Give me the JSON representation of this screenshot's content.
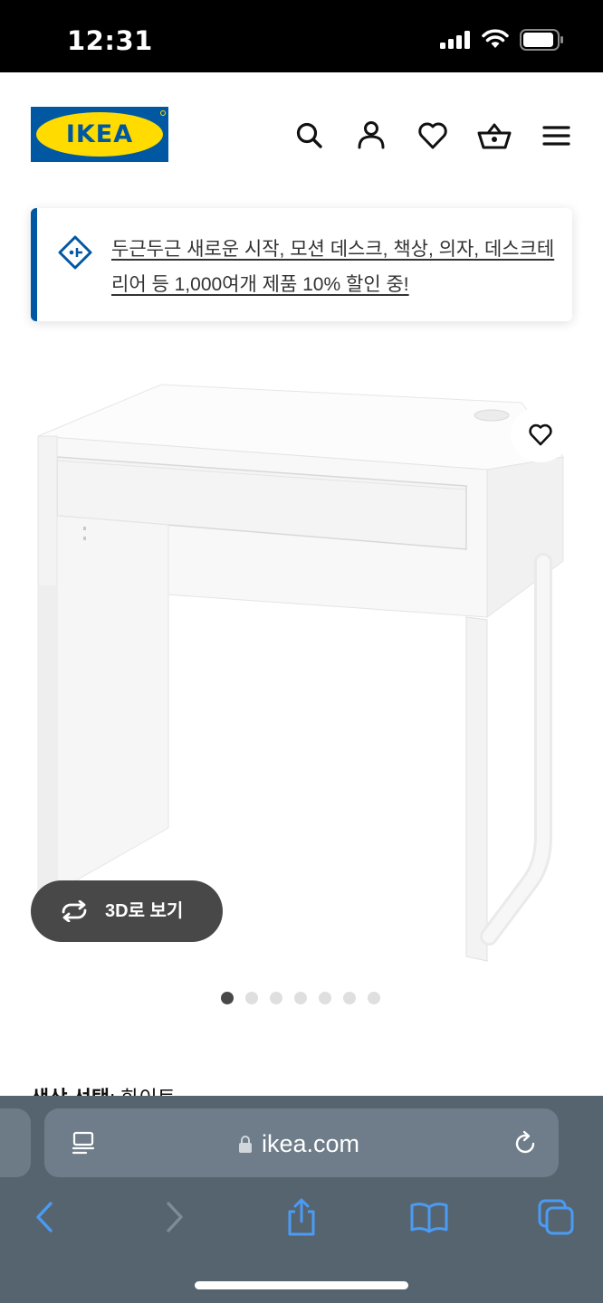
{
  "status_bar": {
    "time": "12:31"
  },
  "header": {
    "logo_text": "IKEA",
    "icons": [
      "search-icon",
      "account-icon",
      "favourites-icon",
      "basket-icon",
      "menu-icon"
    ]
  },
  "promo": {
    "icon": "price-tag-icon",
    "message": "두근두근 새로운 시작, 모션 데스크, 책상, 의자, 데스크테리어 등 1,000여개 제품 10% 할인 중!"
  },
  "product": {
    "favourite_icon": "heart-icon",
    "view_3d_label": "3D로 보기",
    "view_3d_icon": "rotate-icon",
    "carousel": {
      "total": 7,
      "active_index": 0
    }
  },
  "colour_selection": {
    "label": "색상 선택",
    "value": ": 화이트"
  },
  "safari": {
    "url": "ikea.com",
    "toolbar_icons": [
      "back-icon",
      "forward-icon",
      "share-icon",
      "bookmarks-icon",
      "tabs-icon"
    ]
  },
  "colors": {
    "ikea_blue": "#0058a3",
    "ikea_yellow": "#ffdb00",
    "safari_accent": "#4a9bf5"
  }
}
